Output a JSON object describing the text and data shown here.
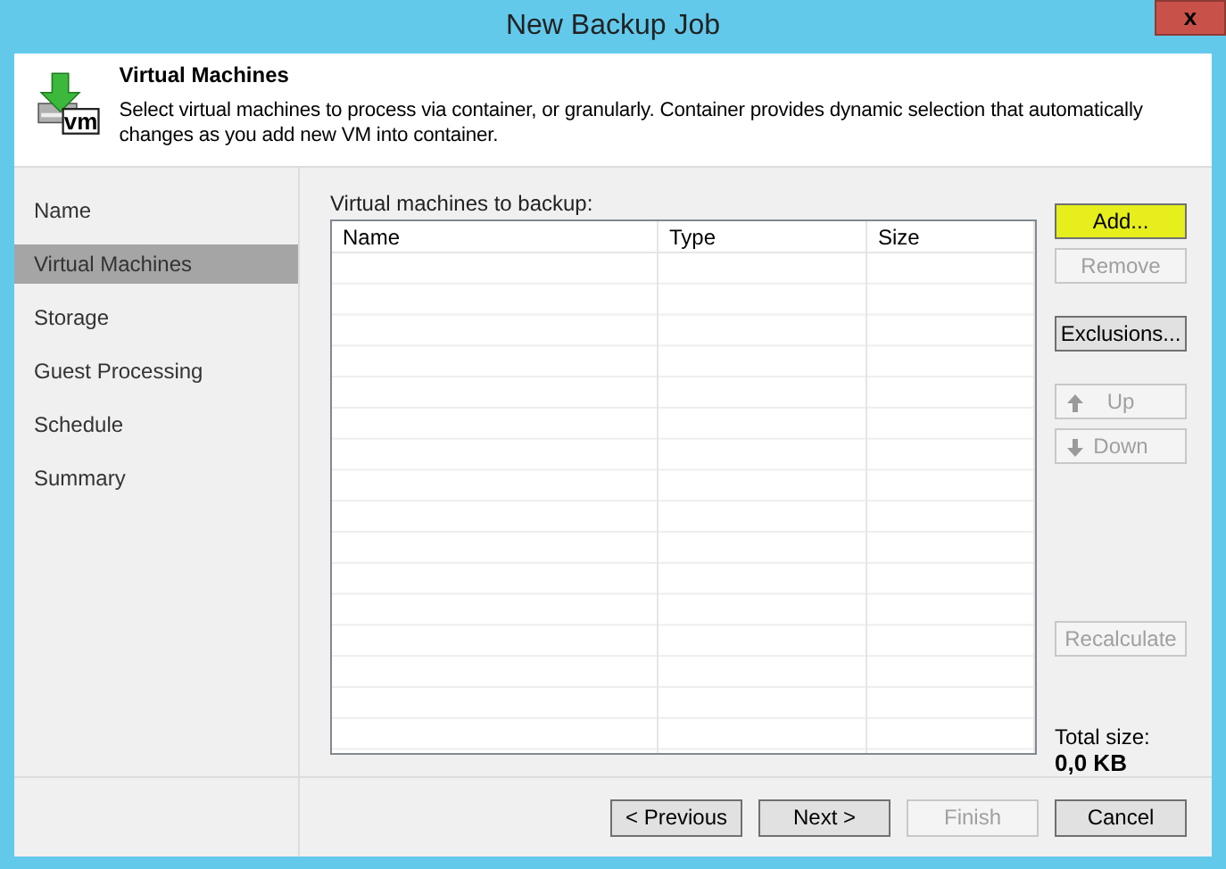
{
  "window": {
    "title": "New Backup Job",
    "close": "x"
  },
  "header": {
    "title": "Virtual Machines",
    "description": "Select virtual machines to process via container, or granularly. Container provides dynamic selection that automatically changes as you add new VM into container.",
    "icon_text": "vm"
  },
  "sidebar": {
    "items": [
      {
        "label": "Name",
        "selected": false
      },
      {
        "label": "Virtual Machines",
        "selected": true
      },
      {
        "label": "Storage",
        "selected": false
      },
      {
        "label": "Guest Processing",
        "selected": false
      },
      {
        "label": "Schedule",
        "selected": false
      },
      {
        "label": "Summary",
        "selected": false
      }
    ]
  },
  "table": {
    "label": "Virtual machines to backup:",
    "columns": [
      "Name",
      "Type",
      "Size"
    ]
  },
  "side_button_groups": [
    [
      {
        "label": "Add...",
        "kind": "plain",
        "disabled": false,
        "highlighted": true
      },
      {
        "label": "Remove",
        "kind": "plain",
        "disabled": true,
        "highlighted": false
      }
    ],
    [
      {
        "label": "Exclusions...",
        "kind": "plain",
        "disabled": false,
        "highlighted": false
      }
    ],
    [
      {
        "label": "Up",
        "kind": "up",
        "disabled": true,
        "highlighted": false
      },
      {
        "label": "Down",
        "kind": "down",
        "disabled": true,
        "highlighted": false
      }
    ]
  ],
  "recalculate": {
    "label": "Recalculate",
    "disabled": true
  },
  "total": {
    "label": "Total size:",
    "value": "0,0 KB"
  },
  "footer_buttons": [
    {
      "label": "< Previous",
      "disabled": false
    },
    {
      "label": "Next >",
      "disabled": false
    },
    {
      "label": "Finish",
      "disabled": true
    },
    {
      "label": "Cancel",
      "disabled": false
    }
  ]
}
